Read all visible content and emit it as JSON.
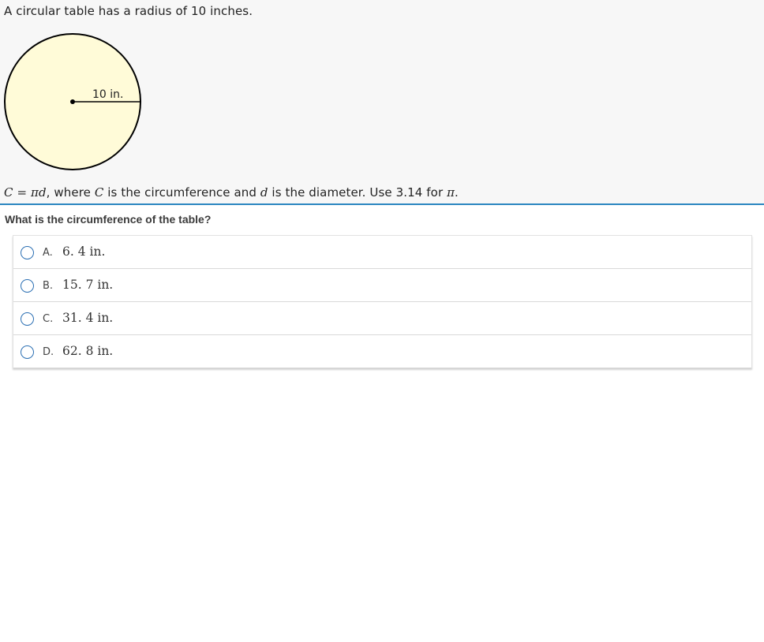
{
  "stimulus": {
    "intro": "A circular table has a radius of 10 inches.",
    "figure": {
      "radius_label": "10 in.",
      "fill_color": "#fffbd8"
    },
    "formula": {
      "C": "C",
      "equals": " = ",
      "pi": "π",
      "d": "d",
      "mid_text": ", where ",
      "C2": "C",
      "text2": " is the circumference and ",
      "d2": "d",
      "text3": " is the diameter. Use 3.14 for ",
      "pi2": "π",
      "end": "."
    }
  },
  "question": {
    "text": "What is the circumference of the table?"
  },
  "choices": [
    {
      "letter": "A.",
      "value": "6. 4 in."
    },
    {
      "letter": "B.",
      "value": "15. 7 in."
    },
    {
      "letter": "C.",
      "value": "31. 4 in."
    },
    {
      "letter": "D.",
      "value": "62. 8 in."
    }
  ],
  "colors": {
    "divider": "#2a86c0",
    "radio_border": "#2b6fb3",
    "stimulus_bg": "#f7f7f7"
  },
  "icons": {
    "radio": "radio-button-icon"
  }
}
